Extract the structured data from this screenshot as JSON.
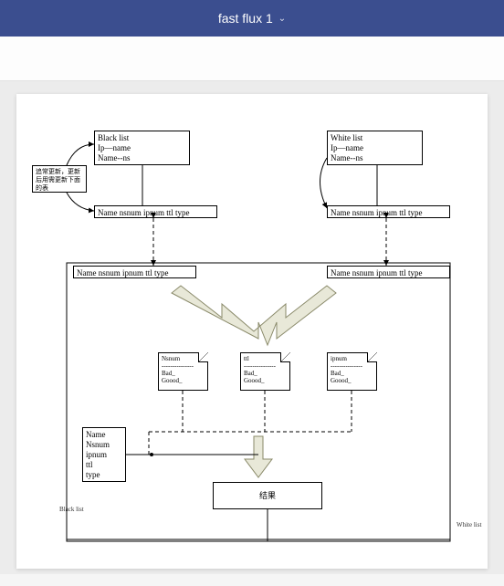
{
  "app": {
    "title": "fast flux 1"
  },
  "diagram": {
    "blacklist": "Black list\nIp—name\nName--ns",
    "whitelist": "White list\nIp—name\nName--ns",
    "update_note": "追常更新，更新后用需更新下面的表",
    "rec_top_left": "Name nsnum ipnum ttl type",
    "rec_top_right": "Name nsnum ipnum ttl type",
    "rec_mid_left": "Name nsnum ipnum ttl type",
    "rec_mid_right": "Name nsnum ipnum ttl type",
    "note1": "Nsnum\n---------------\nBad_\nGoood_",
    "note2": "ttl\n---------------\nBad_\nGoood_",
    "note3": "ipnum\n---------------\nBad_\nGoood_",
    "detail": "Name\nNsnum\nipnum\nttl\ntype",
    "result": "结果",
    "label_black": "Black list",
    "label_white": "White list"
  }
}
